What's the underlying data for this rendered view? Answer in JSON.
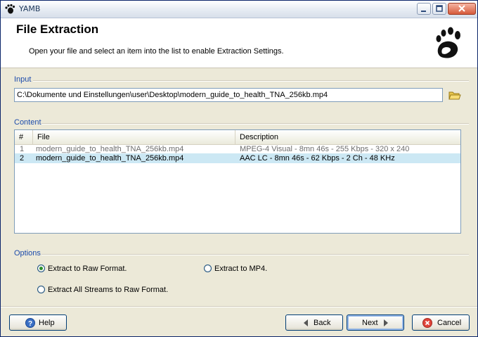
{
  "window": {
    "title": "YAMB"
  },
  "header": {
    "title": "File Extraction",
    "subtitle": "Open your file and select an item into the list to enable Extraction Settings."
  },
  "input": {
    "label": "Input",
    "path": "C:\\Dokumente und Einstellungen\\user\\Desktop\\modern_guide_to_health_TNA_256kb.mp4"
  },
  "content": {
    "label": "Content",
    "columns": [
      "#",
      "File",
      "Description"
    ],
    "rows": [
      {
        "num": "1",
        "file": "modern_guide_to_health_TNA_256kb.mp4",
        "description": "MPEG-4 Visual - 8mn 46s - 255 Kbps - 320 x 240",
        "selected": false
      },
      {
        "num": "2",
        "file": "modern_guide_to_health_TNA_256kb.mp4",
        "description": "AAC LC - 8mn 46s - 62 Kbps - 2 Ch - 48 KHz",
        "selected": true
      }
    ]
  },
  "options": {
    "label": "Options",
    "raw": {
      "label": "Extract to Raw Format.",
      "checked": true
    },
    "mp4": {
      "label": "Extract to MP4.",
      "checked": false
    },
    "all_streams": {
      "label": "Extract All Streams to Raw Format.",
      "checked": false
    }
  },
  "buttons": {
    "help": "Help",
    "back": "Back",
    "next": "Next",
    "cancel": "Cancel"
  },
  "colors": {
    "group_label": "#1c4bab",
    "selection": "#cce8f4",
    "window_bg": "#ece9d8"
  }
}
